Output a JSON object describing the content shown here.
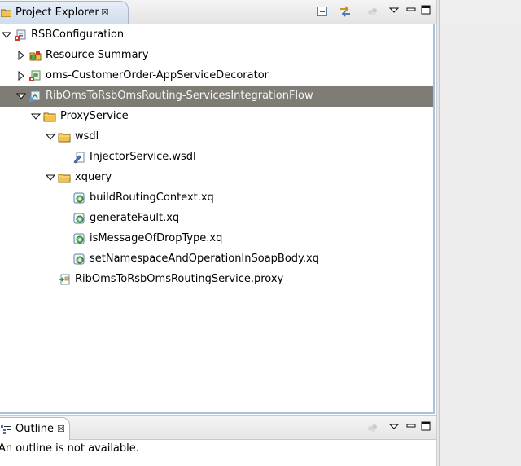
{
  "project_explorer": {
    "title": "Project Explorer",
    "toolbar": {
      "collapse_all": "collapse-all-icon",
      "link_with_editor": "link-with-editor-icon",
      "disabled_action": "disabled-action-icon",
      "view_menu": "view-menu-icon",
      "minimize": "minimize-icon",
      "maximize": "maximize-icon"
    },
    "tree": {
      "rsb_configuration": "RSBConfiguration",
      "resource_summary": "Resource Summary",
      "oms_decorator": "oms-CustomerOrder-AppServiceDecorator",
      "routing_flow": "RibOmsToRsbOmsRouting-ServicesIntegrationFlow",
      "proxy_service": "ProxyService",
      "wsdl_folder": "wsdl",
      "injector_wsdl": "InjectorService.wsdl",
      "xquery_folder": "xquery",
      "xq_build": "buildRoutingContext.xq",
      "xq_fault": "generateFault.xq",
      "xq_drop": "isMessageOfDropType.xq",
      "xq_namespace": "setNamespaceAndOperationInSoapBody.xq",
      "proxy_file": "RibOmsToRsbOmsRoutingService.proxy"
    },
    "selected": "RibOmsToRsbOmsRouting-ServicesIntegrationFlow"
  },
  "outline": {
    "title": "Outline",
    "message": "An outline is not available."
  },
  "colors": {
    "selection": "#7f7c75",
    "view_border": "#a7c2de",
    "folder": "#f2c14e"
  }
}
